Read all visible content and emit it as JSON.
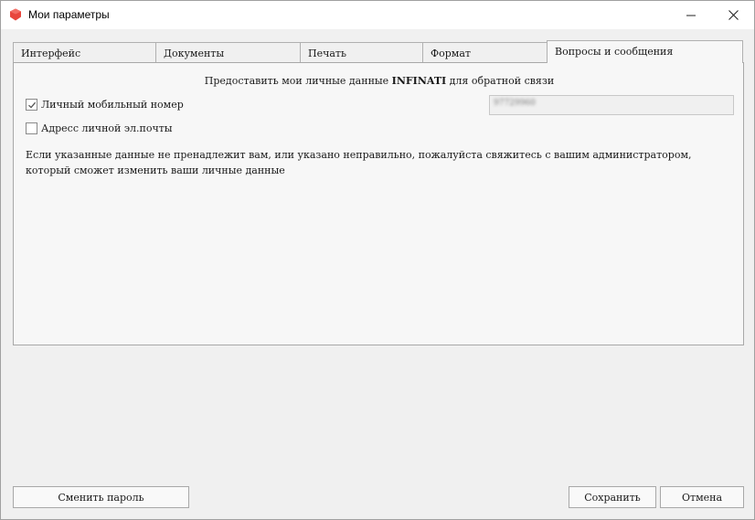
{
  "window": {
    "title": "Мои параметры",
    "accent_color": "#e8453c"
  },
  "tabs": [
    {
      "label": "Интерфейс"
    },
    {
      "label": "Документы"
    },
    {
      "label": "Печать"
    },
    {
      "label": "Формат"
    },
    {
      "label": "Вопросы и сообщения",
      "active": true
    }
  ],
  "panel": {
    "heading_prefix": "Предоставить мои личные данные",
    "heading_brand": "INFINATI",
    "heading_suffix": "для обратной связи",
    "mobile": {
      "label": "Личный мобильный номер",
      "checked": true,
      "value": "97729960"
    },
    "email": {
      "label": "Адресс личной эл.почты",
      "checked": false
    },
    "info_text": "Если указанные данные не пренадлежит вам, или указано неправильно, пожалуйста свяжитесь с вашим администратором, который сможет изменить ваши личные данные"
  },
  "buttons": {
    "change_password": "Сменить пароль",
    "save": "Сохранить",
    "cancel": "Отмена"
  }
}
